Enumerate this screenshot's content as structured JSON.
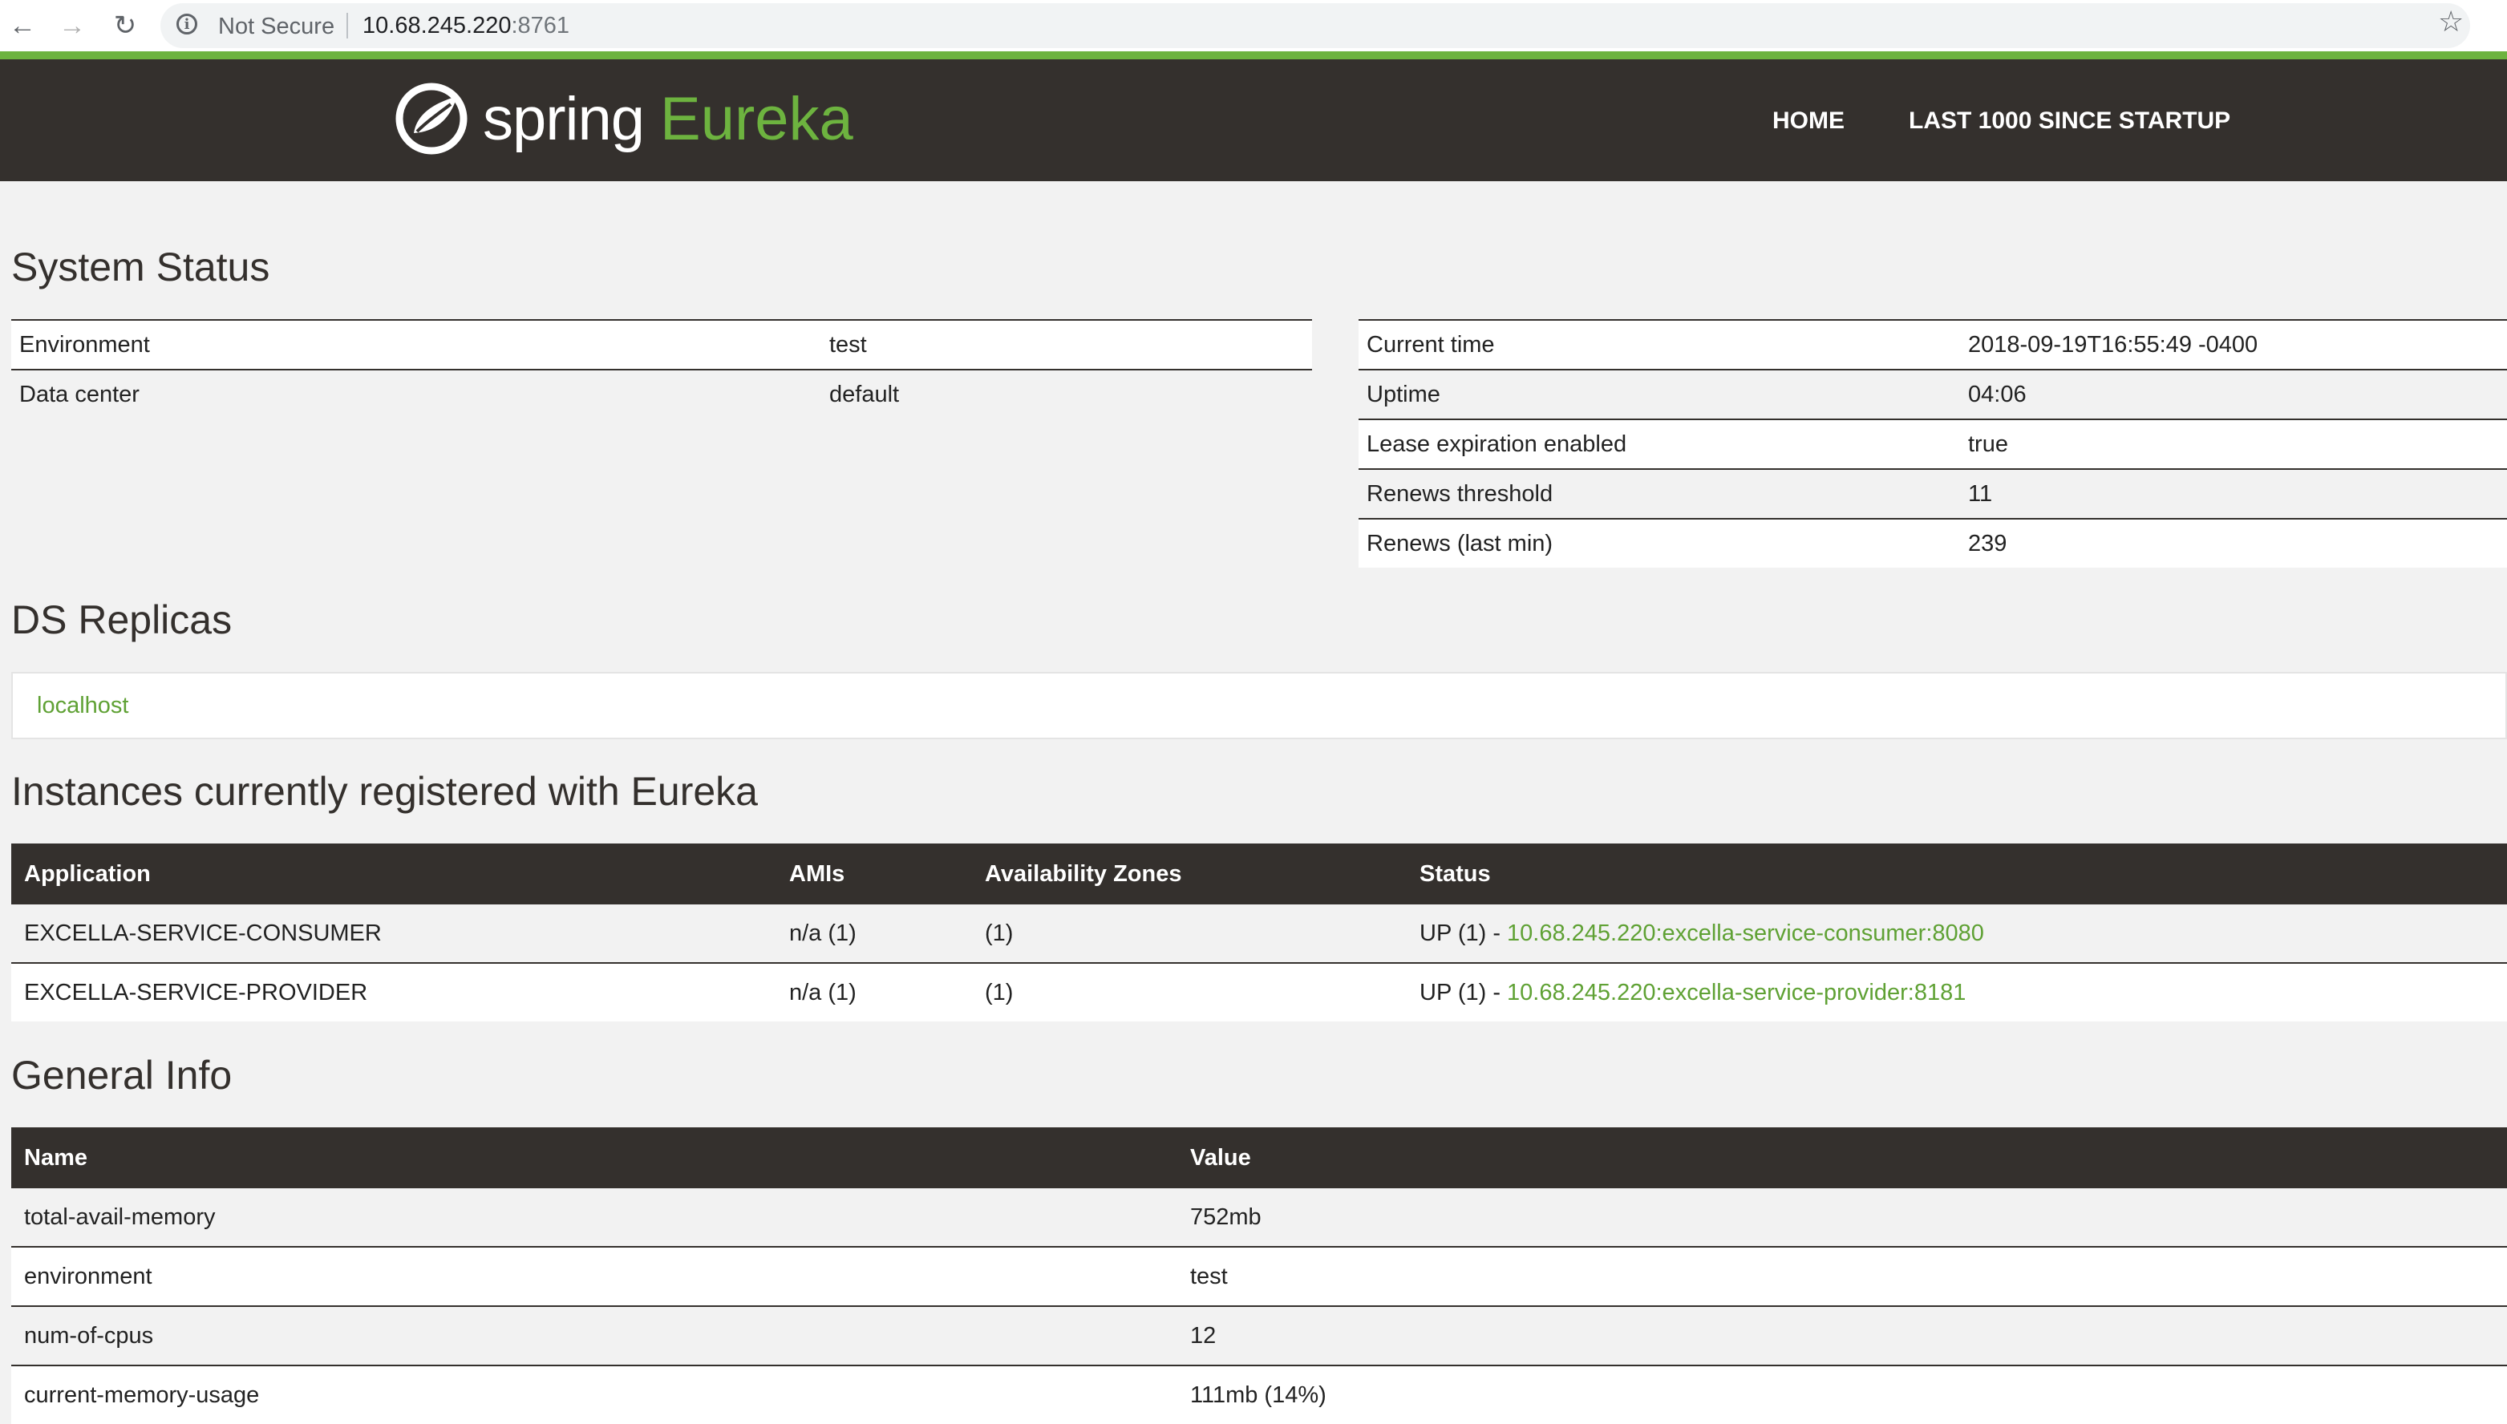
{
  "browser": {
    "security_text": "Not Secure",
    "host": "10.68.245.220",
    "port": ":8761"
  },
  "header": {
    "brand_spring": "spring",
    "brand_eureka": "Eureka",
    "nav": [
      "HOME",
      "LAST 1000 SINCE STARTUP"
    ]
  },
  "system_status": {
    "title": "System Status",
    "left": [
      {
        "name": "Environment",
        "value": "test"
      },
      {
        "name": "Data center",
        "value": "default"
      }
    ],
    "right": [
      {
        "name": "Current time",
        "value": "2018-09-19T16:55:49 -0400"
      },
      {
        "name": "Uptime",
        "value": "04:06"
      },
      {
        "name": "Lease expiration enabled",
        "value": "true"
      },
      {
        "name": "Renews threshold",
        "value": "11"
      },
      {
        "name": "Renews (last min)",
        "value": "239"
      }
    ]
  },
  "ds_replicas": {
    "title": "DS Replicas",
    "items": [
      "localhost"
    ]
  },
  "instances": {
    "title": "Instances currently registered with Eureka",
    "headers": [
      "Application",
      "AMIs",
      "Availability Zones",
      "Status"
    ],
    "rows": [
      {
        "application": "EXCELLA-SERVICE-CONSUMER",
        "amis": "n/a (1)",
        "zones": "(1)",
        "status_prefix": "UP (1) - ",
        "status_link": "10.68.245.220:excella-service-consumer:8080"
      },
      {
        "application": "EXCELLA-SERVICE-PROVIDER",
        "amis": "n/a (1)",
        "zones": "(1)",
        "status_prefix": "UP (1) - ",
        "status_link": "10.68.245.220:excella-service-provider:8181"
      }
    ]
  },
  "general_info": {
    "title": "General Info",
    "headers": [
      "Name",
      "Value"
    ],
    "rows": [
      {
        "name": "total-avail-memory",
        "value": "752mb"
      },
      {
        "name": "environment",
        "value": "test"
      },
      {
        "name": "num-of-cpus",
        "value": "12"
      },
      {
        "name": "current-memory-usage",
        "value": "111mb (14%)"
      }
    ]
  },
  "colors": {
    "brand_green": "#6db33f",
    "header_dark": "#34302d",
    "link_green": "#5fa134"
  }
}
